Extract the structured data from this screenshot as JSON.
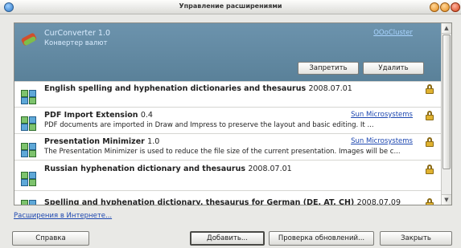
{
  "window": {
    "title": "Управление расширениями",
    "app_icon": "app-icon",
    "controls": [
      "minimize-icon",
      "maximize-icon",
      "close-icon"
    ]
  },
  "extensions": [
    {
      "name": "CurConverter",
      "version": "1.0",
      "description": "Конвертер валют",
      "publisher": "OOoCluster",
      "icon": "currency-converter-icon",
      "selected": true,
      "buttons": {
        "disable": "Запретить",
        "remove": "Удалить"
      }
    },
    {
      "name": "English spelling and hyphenation dictionaries and thesaurus",
      "version": "2008.07.01",
      "description": "",
      "publisher": "",
      "icon": "puzzle-icon",
      "locked": true
    },
    {
      "name": "PDF Import Extension",
      "version": "0.4",
      "description": "PDF documents are imported in Draw and Impress to preserve the layout and basic editing. It ...",
      "publisher": "Sun Microsystems",
      "icon": "puzzle-icon",
      "locked": true
    },
    {
      "name": "Presentation Minimizer",
      "version": "1.0",
      "description": "The Presentation Minimizer is used to reduce the file size of the current presentation. Images will be c...",
      "publisher": "Sun Microsystems",
      "icon": "puzzle-icon",
      "locked": true
    },
    {
      "name": "Russian hyphenation dictionary and thesaurus",
      "version": "2008.07.01",
      "description": "",
      "publisher": "",
      "icon": "puzzle-icon",
      "locked": true
    },
    {
      "name": "Spelling and hyphenation dictionary, thesaurus for German (DE, AT, CH)",
      "version": "2008.07.09",
      "description": "",
      "publisher": "",
      "icon": "puzzle-icon",
      "locked": true
    }
  ],
  "more_extensions_link": "Расширения в Интернете...",
  "footer": {
    "help": "Справка",
    "add": "Добавить...",
    "check_updates": "Проверка обновлений...",
    "close": "Закрыть"
  }
}
